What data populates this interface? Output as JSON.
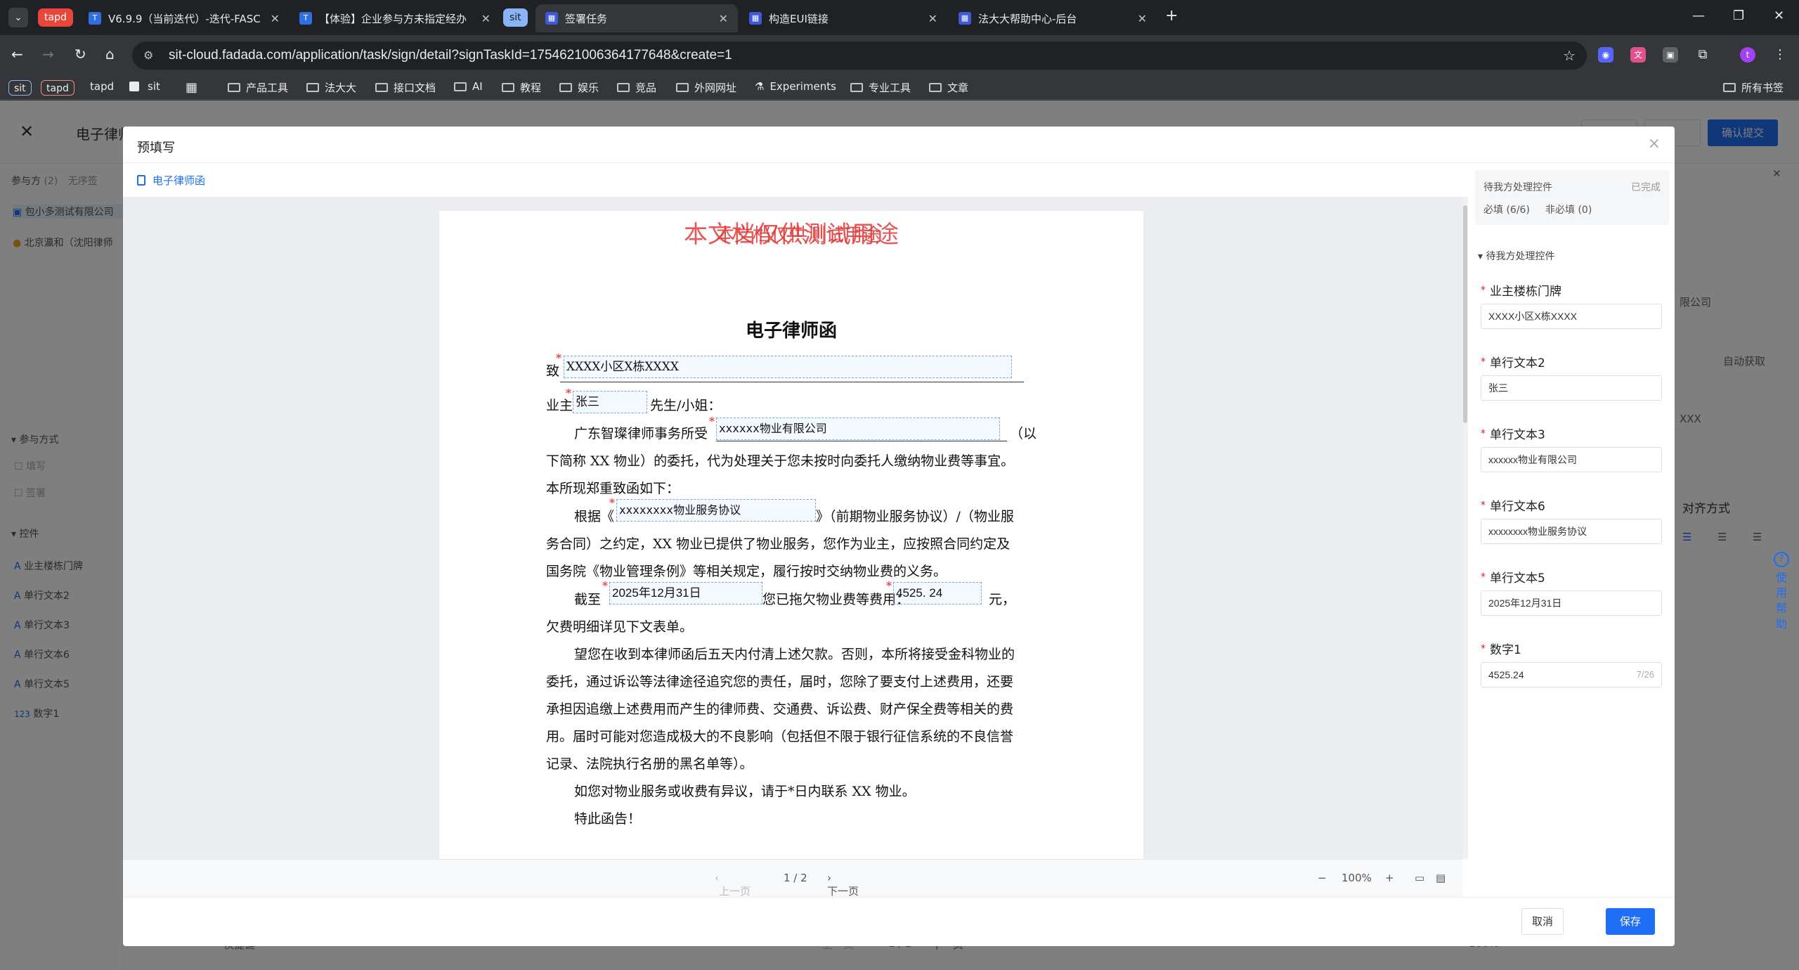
{
  "browser": {
    "tabs": [
      {
        "pill": "tapd"
      },
      {
        "label": "V6.9.9（当前迭代）-迭代-FASC",
        "fav": "T"
      },
      {
        "label": "【体验】企业参与方未指定经办",
        "fav": "T"
      },
      {
        "pill": "sit"
      },
      {
        "label": "签署任务",
        "fav": "▦",
        "active": true
      },
      {
        "label": "构造EUI链接",
        "fav": "▦"
      },
      {
        "label": "法大大帮助中心-后台",
        "fav": "▦"
      }
    ],
    "url": "sit-cloud.fadada.com/application/task/sign/detail?signTaskId=1754621006364177648&create=1",
    "bookmarks": {
      "pill1": "sit",
      "pill2": "tapd",
      "tapd": "tapd",
      "sit": "sit",
      "folders": [
        "产品工具",
        "法大大",
        "接口文档",
        "AI",
        "教程",
        "娱乐",
        "竞品",
        "外网网址",
        "Experiments",
        "专业工具",
        "文章"
      ],
      "all": "所有书签"
    }
  },
  "app": {
    "title": "电子律师函",
    "confirm": "确认提交",
    "left": {
      "participants_label": "参与方",
      "participants_count": "(2)",
      "order": "无序签",
      "p1": "包小多测试有限公司",
      "p2": "北京瀛和（沈阳律师",
      "mode_title": "参与方式",
      "mode1": "填写",
      "mode2": "签署",
      "controls_title": "控件",
      "controls": [
        "业主楼栋门牌",
        "单行文本2",
        "单行文本3",
        "单行文本6",
        "单行文本5",
        "数字1"
      ]
    },
    "right": {
      "company": "限公司",
      "auto": "自动获取",
      "xxx": "XXX",
      "align": "对齐方式"
    },
    "bottom": {
      "prev": "上一页",
      "page": "1 / 2",
      "next": "下一页",
      "zoom": "100%",
      "shortcut": "快捷键"
    }
  },
  "modal": {
    "title": "预填写",
    "doc_tab": "电子律师函",
    "watermark": "本文档仅供测试用途",
    "doc": {
      "heading": "电子律师函",
      "to": "致",
      "owner": "业主",
      "sir": "先生/小姐：",
      "p1a": "广东智璨律师事务所受",
      "p1b": "（以",
      "p1c": "下简称 XX 物业）的委托，代为处理关于您未按时向委托人缴纳物业费等事宜。",
      "p1d": "本所现郑重致函如下：",
      "p2a": "根据《",
      "p2b": "》（前期物业服务协议）/（物业服",
      "p2c": "务合同）之约定，XX 物业已提供了物业服务，您作为业主，应按照合同约定及",
      "p2d": "国务院《物业管理条例》等相关规定，履行按时交纳物业费的义务。",
      "p3a": "截至",
      "p3b": "您已拖欠物业费等费用：",
      "p3c": "元，",
      "p3d": "欠费明细详见下文表单。",
      "p4a": "望您在收到本律师函后五天内付清上述欠款。否则，本所将接受金科物业的",
      "p4b": "委托，通过诉讼等法律途径追究您的责任，届时，您除了要支付上述费用，还要",
      "p4c": "承担因追缴上述费用而产生的律师费、交通费、诉讼费、财产保全费等相关的费",
      "p4d": "用。届时可能对您造成极大的不良影响（包括但不限于银行征信系统的不良信誉",
      "p4e": "记录、法院执行名册的黑名单等）。",
      "p5": "如您对物业服务或收费有异议，请于*日内联系 XX 物业。",
      "p6": "特此函告！",
      "f_building": "XXXX小区X栋XXXX",
      "f_name": "张三",
      "f_company": "xxxxxx物业有限公司",
      "f_contract": "xxxxxxxx物业服务协议",
      "f_date": "2025年12月31日",
      "f_amount": "4525. 24"
    },
    "pager": {
      "prev": "上一页",
      "page": "1 / 2",
      "next": "下一页",
      "zoom": "100%"
    },
    "side": {
      "pending_title": "待我方处理控件",
      "done": "已完成",
      "required": "必填 (6/6)",
      "optional": "非必填 (0)",
      "group": "待我方处理控件",
      "items": [
        {
          "label": "业主楼栋门牌",
          "value": "XXXX小区X栋XXXX"
        },
        {
          "label": "单行文本2",
          "value": "张三"
        },
        {
          "label": "单行文本3",
          "value": "xxxxxx物业有限公司"
        },
        {
          "label": "单行文本6",
          "value": "xxxxxxxx物业服务协议"
        },
        {
          "label": "单行文本5",
          "value": "2025年12月31日"
        },
        {
          "label": "数字1",
          "value": "4525.24",
          "count": "7/26"
        }
      ]
    },
    "cancel": "取消",
    "save": "保存"
  },
  "help": "使用帮助"
}
